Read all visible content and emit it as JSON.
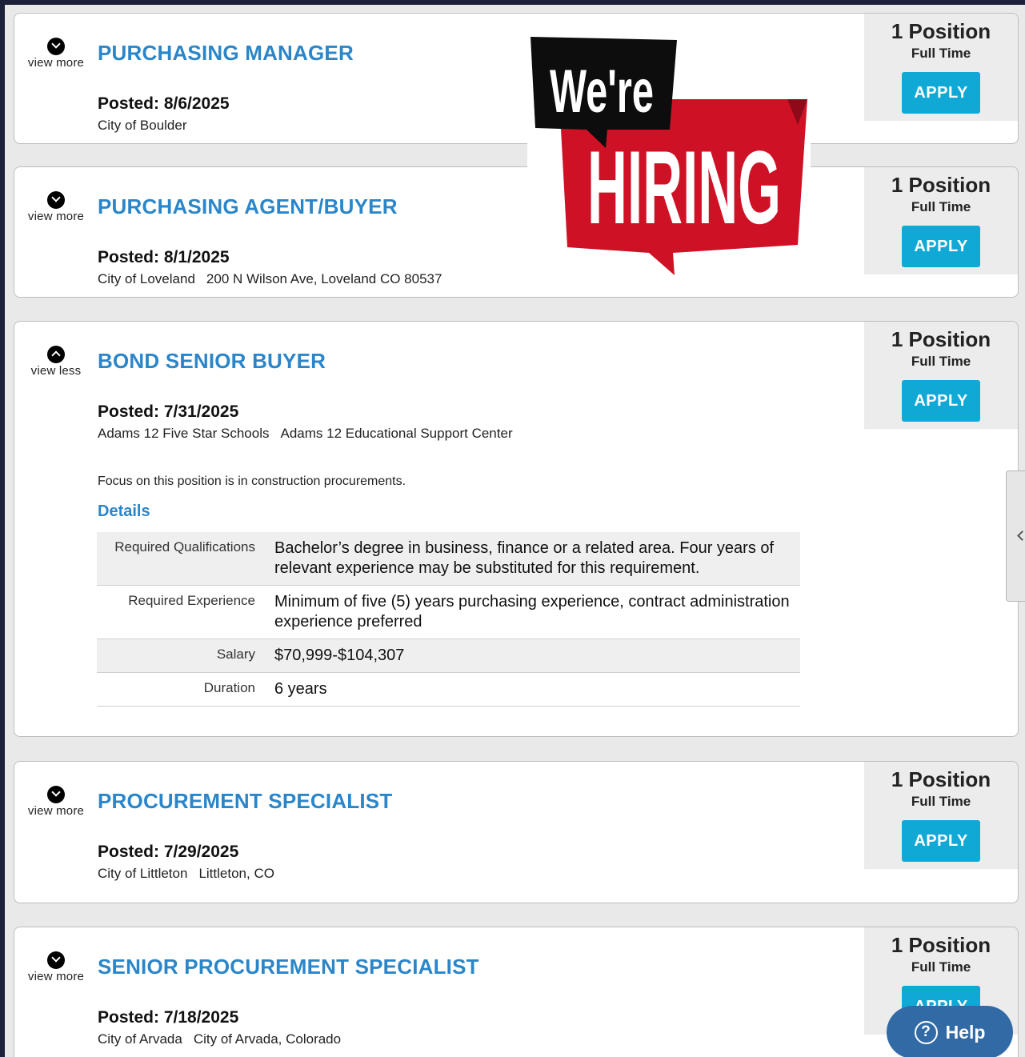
{
  "jobs": [
    {
      "toggle": "view more",
      "title": "PURCHASING MANAGER",
      "posted": "Posted: 8/6/2025",
      "employer": "City of Boulder",
      "address": "",
      "positions": "1 Position",
      "type": "Full Time",
      "apply": "APPLY"
    },
    {
      "toggle": "view more",
      "title": "PURCHASING AGENT/BUYER",
      "posted": "Posted: 8/1/2025",
      "employer": "City of Loveland",
      "address": "200 N Wilson Ave, Loveland CO 80537",
      "positions": "1 Position",
      "type": "Full Time",
      "apply": "APPLY"
    },
    {
      "toggle": "view less",
      "title": "BOND SENIOR BUYER",
      "posted": "Posted: 7/31/2025",
      "employer": "Adams 12 Five Star Schools",
      "address": "Adams 12 Educational Support Center",
      "positions": "1 Position",
      "type": "Full Time",
      "apply": "APPLY",
      "description": "Focus on this position is in construction procurements.",
      "details_label": "Details",
      "details": [
        {
          "label": "Required Qualifications",
          "value": "Bachelor’s degree in business, finance or a related area. Four years of relevant experience may be substituted for this requirement."
        },
        {
          "label": "Required Experience",
          "value": "Minimum of five (5) years purchasing experience, contract administration experience preferred"
        },
        {
          "label": "Salary",
          "value": "$70,999-$104,307"
        },
        {
          "label": "Duration",
          "value": "6 years"
        }
      ]
    },
    {
      "toggle": "view more",
      "title": "PROCUREMENT SPECIALIST",
      "posted": "Posted: 7/29/2025",
      "employer": "City of Littleton",
      "address": "Littleton, CO",
      "positions": "1 Position",
      "type": "Full Time",
      "apply": "APPLY"
    },
    {
      "toggle": "view more",
      "title": "SENIOR PROCUREMENT SPECIALIST",
      "posted": "Posted: 7/18/2025",
      "employer": "City of Arvada",
      "address": "City of Arvada, Colorado",
      "positions": "1 Position",
      "type": "Full Time",
      "apply": "APPLY"
    }
  ],
  "hiring_banner": {
    "line1": "We're",
    "line2": "HIRING",
    "colors": {
      "black": "#0d0d0d",
      "red": "#cf1126",
      "dark_red": "#8e0a18"
    }
  },
  "help_button": {
    "label": "Help",
    "icon": "question-icon",
    "glyph": "?"
  },
  "side_tab": {
    "icon": "chevron-left-icon"
  },
  "colors": {
    "link_blue": "#2b86c9",
    "apply_blue": "#10a9d6",
    "help_blue": "#326aa6",
    "frame": "#1c2038"
  }
}
